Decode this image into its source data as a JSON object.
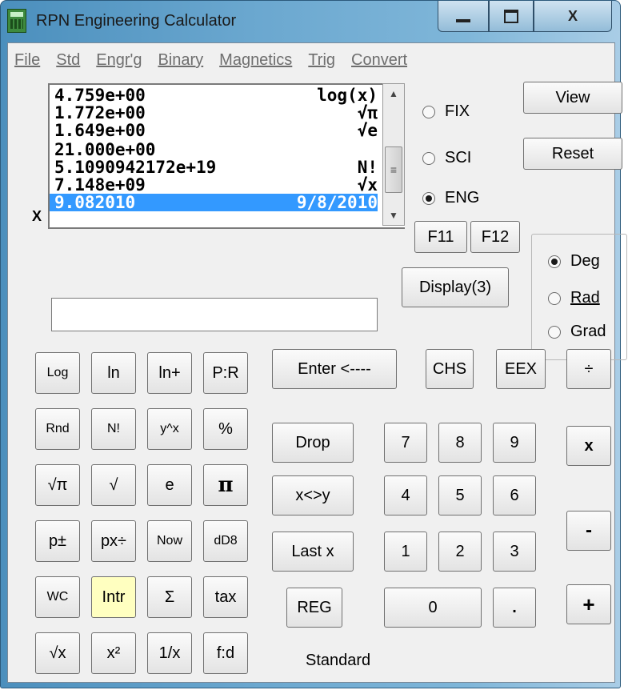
{
  "window": {
    "title": "RPN Engineering Calculator",
    "close_glyph": "X"
  },
  "menu": [
    "File",
    "Std",
    "Engr'g",
    "Binary",
    "Magnetics",
    "Trig",
    "Convert"
  ],
  "stack": [
    {
      "value": "4.759e+00",
      "op": "log(x)"
    },
    {
      "value": "1.772e+00",
      "op": "√π"
    },
    {
      "value": "1.649e+00",
      "op": "√e"
    },
    {
      "value": "21.000e+00",
      "op": ""
    },
    {
      "value": "5.1090942172e+19",
      "op": "N!"
    },
    {
      "value": "7.148e+09",
      "op": "√x"
    },
    {
      "value": "9.082010",
      "op": "9/8/2010",
      "selected": true
    }
  ],
  "x_label": "X",
  "display_modes": {
    "fix": "FIX",
    "sci": "SCI",
    "eng": "ENG",
    "selected": "ENG"
  },
  "angle_modes": {
    "deg": "Deg",
    "rad": "Rad",
    "grad": "Grad",
    "selected": "Deg"
  },
  "side_buttons": {
    "view": "View",
    "reset": "Reset",
    "f11": "F11",
    "f12": "F12",
    "display": "Display(3)"
  },
  "input_value": "",
  "function_keys": [
    [
      "Log",
      "ln",
      "ln+",
      "P:R"
    ],
    [
      "Rnd",
      "N!",
      "y^x",
      "%"
    ],
    [
      "√π",
      "√",
      "e",
      "π"
    ],
    [
      "p±",
      "px÷",
      "Now",
      "dD8"
    ],
    [
      "WC",
      "Intr",
      "Σ",
      "tax"
    ],
    [
      "√x",
      "x²",
      "1/x",
      "f:d"
    ]
  ],
  "stack_keys": {
    "enter": "Enter <----",
    "drop": "Drop",
    "swap": "x<>y",
    "lastx": "Last x",
    "reg": "REG"
  },
  "top_keys": {
    "chs": "CHS",
    "eex": "EEX",
    "divide": "÷"
  },
  "digits": [
    [
      "7",
      "8",
      "9"
    ],
    [
      "4",
      "5",
      "6"
    ],
    [
      "1",
      "2",
      "3"
    ]
  ],
  "zero": "0",
  "dot": ".",
  "ops": {
    "multiply": "x",
    "minus": "-",
    "plus": "+"
  },
  "status": "Standard",
  "colors": {
    "selection": "#3399ff",
    "highlight_key": "#ffffc0"
  }
}
